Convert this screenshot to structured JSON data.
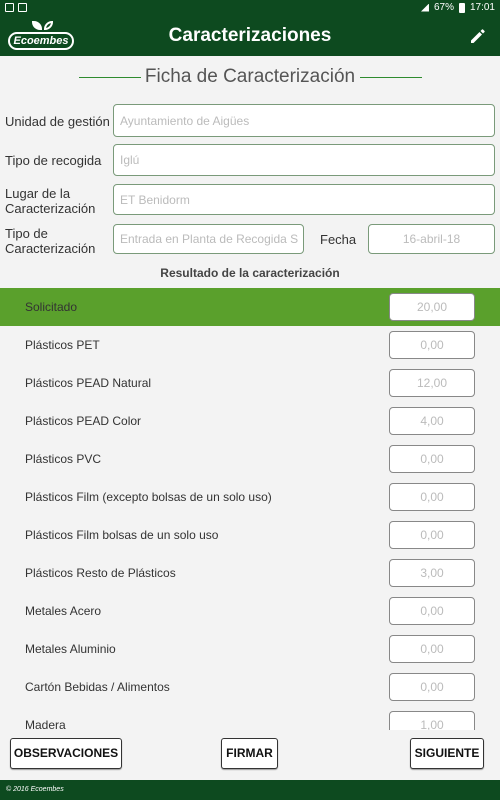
{
  "status_bar": {
    "battery": "67%",
    "time": "17:01"
  },
  "app_bar": {
    "logo_text": "Ecoembes",
    "title": "Caracterizaciones",
    "edit_icon": "pencil-icon"
  },
  "form": {
    "title": "Ficha de Caracterización",
    "unidad_label": "Unidad de gestión",
    "unidad_value": "Ayuntamiento de Aigües",
    "tipo_recogida_label": "Tipo de recogida",
    "tipo_recogida_value": "Iglú",
    "lugar_label_1": "Lugar de la",
    "lugar_label_2": "Caracterización",
    "lugar_value": "ET Benidorm",
    "tipo_car_label_1": "Tipo de",
    "tipo_car_label_2": "Caracterización",
    "tipo_car_value": "Entrada en Planta de Recogida S",
    "fecha_label": "Fecha",
    "fecha_value": "16-abril-18"
  },
  "results": {
    "title": "Resultado de la caracterización",
    "rows": [
      {
        "label": "Solicitado",
        "value": "20,00"
      },
      {
        "label": "Plásticos PET",
        "value": "0,00"
      },
      {
        "label": "Plásticos PEAD Natural",
        "value": "12,00"
      },
      {
        "label": "Plásticos PEAD Color",
        "value": "4,00"
      },
      {
        "label": "Plásticos PVC",
        "value": "0,00"
      },
      {
        "label": "Plásticos Film (excepto bolsas de un solo uso)",
        "value": "0,00"
      },
      {
        "label": "Plásticos Film bolsas de un solo uso",
        "value": "0,00"
      },
      {
        "label": "Plásticos Resto de Plásticos",
        "value": "3,00"
      },
      {
        "label": "Metales Acero",
        "value": "0,00"
      },
      {
        "label": "Metales Aluminio",
        "value": "0,00"
      },
      {
        "label": "Cartón Bebidas / Alimentos",
        "value": "0,00"
      },
      {
        "label": "Madera",
        "value": "1,00"
      }
    ]
  },
  "buttons": {
    "observaciones": "OBSERVACIONES",
    "firmar": "FIRMAR",
    "siguiente": "SIGUIENTE"
  },
  "footer": {
    "copyright": "© 2016 Ecoembes"
  },
  "colors": {
    "primary_dark": "#0d4a1f",
    "selected_row": "#5aa02c",
    "accent_line": "#2e8b2e"
  }
}
